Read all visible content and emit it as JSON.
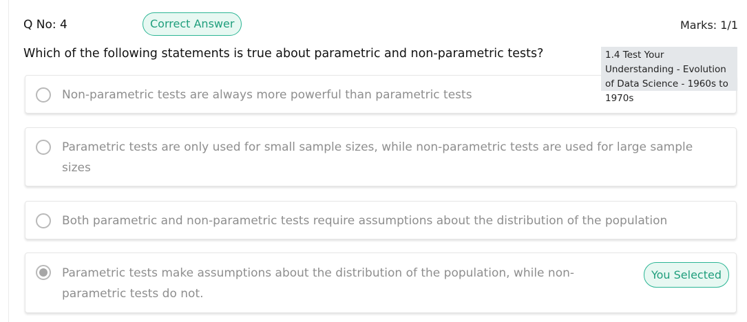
{
  "header": {
    "question_number": "Q No: 4",
    "correct_badge": "Correct Answer",
    "marks": "Marks: 1/1"
  },
  "question": {
    "text": "Which of the following statements is true about parametric and non-parametric tests?"
  },
  "tooltip": {
    "text": "1.4 Test Your Understanding - Evolution of Data Science - 1960s to 1970s"
  },
  "options": [
    {
      "text": "Non-parametric tests are always more powerful than parametric tests",
      "selected": false
    },
    {
      "text": "Parametric tests are only used for small sample sizes, while non-parametric tests are used for large sample sizes",
      "selected": false
    },
    {
      "text": "Both parametric and non-parametric tests require assumptions about the distribution of the population",
      "selected": false
    },
    {
      "text": "Parametric tests make assumptions about the distribution of the population, while non-parametric tests do not.",
      "selected": true,
      "badge": "You Selected"
    }
  ],
  "colors": {
    "accent": "#2bb594",
    "accent_text": "#1f9e7c",
    "badge_background": "#e7f8f2",
    "option_text": "#8e8e8e",
    "tooltip_background": "#e4e7ea"
  }
}
